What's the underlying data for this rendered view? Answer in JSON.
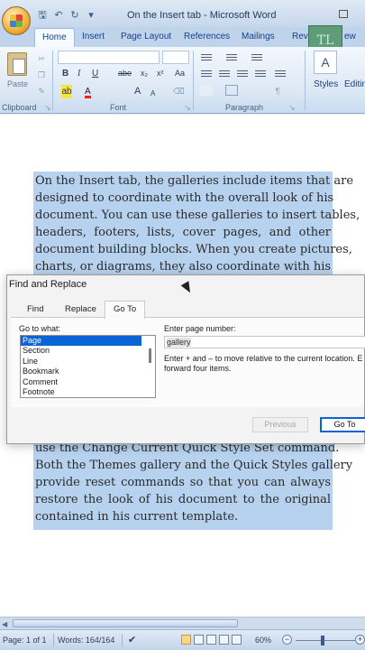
{
  "window": {
    "title": "On the Insert tab - Microsoft Word",
    "qat_icons": [
      "save-icon",
      "undo-icon",
      "redo-icon",
      "customize-icon"
    ]
  },
  "ribbon": {
    "tabs": [
      "Home",
      "Insert",
      "Page Layout",
      "References",
      "Mailings",
      "Revi",
      "ew"
    ],
    "groups": {
      "clipboard": "Clipboard",
      "font": "Font",
      "paragraph": "Paragraph",
      "styles": "Styles",
      "editing": "Editin"
    },
    "paste_label": "Paste",
    "bold": "B",
    "italic": "I",
    "underline": "U",
    "strike": "abe",
    "sub": "x₂",
    "super": "x²",
    "change_case": "Aa",
    "grow": "A",
    "shrink": "A",
    "font_color_letter": "A",
    "avatar_text": "TL"
  },
  "document": {
    "lines_top": [
      "On the Insert tab, the galleries include items that are",
      "designed to coordinate with the overall look of his",
      "document. You can use these galleries to insert tables,",
      "headers, footers, lists, cover pages, and other",
      "document building blocks. When you create pictures,",
      "charts, or diagrams, they also coordinate with his"
    ],
    "lines_bottom": [
      "use the Change Current Quick Style Set command.",
      "Both the Themes gallery and the Quick Styles gallery",
      "provide reset commands so that you can always",
      "restore the look of his document to the original",
      "contained in his current template."
    ]
  },
  "dialog": {
    "title": "Find and Replace",
    "tabs": [
      "Find",
      "Replace",
      "Go To"
    ],
    "active_tab": "Go To",
    "go_to_what_label": "Go to what:",
    "go_to_items": [
      "Page",
      "Section",
      "Line",
      "Bookmark",
      "Comment",
      "Footnote"
    ],
    "selected_item": "Page",
    "page_number_label": "Enter page number:",
    "page_number_value": "gallery",
    "help_line1": "Enter + and – to move relative to the current location. E",
    "help_line2": "forward four items.",
    "previous_button": "Previous",
    "goto_button": "Go To"
  },
  "status": {
    "page": "Page: 1 of 1",
    "words": "Words: 164/164",
    "zoom": "60%",
    "zoom_minus": "−",
    "zoom_plus": "+"
  },
  "colors": {
    "selection": "#b7d2ee",
    "dialog_accent": "#0a64d6",
    "ribbon_tab_text": "#15428b"
  }
}
